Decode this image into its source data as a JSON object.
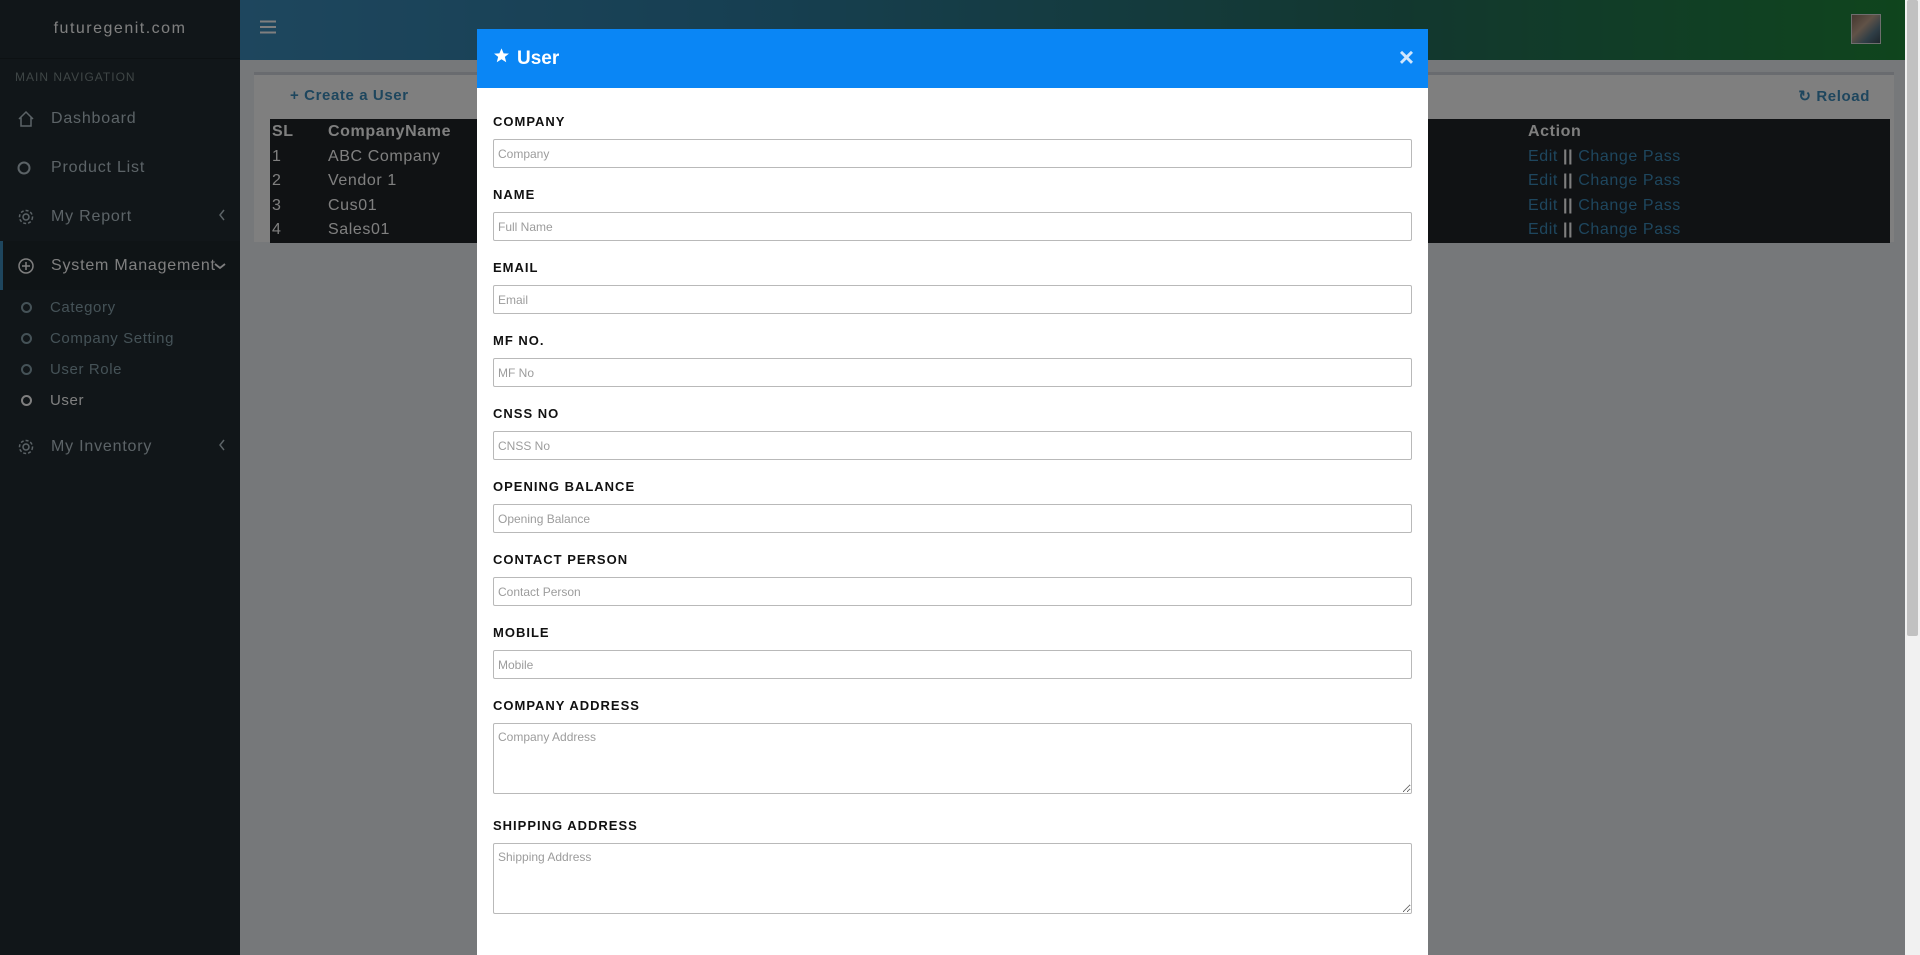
{
  "brand": "futuregenit.com",
  "sidebar": {
    "header": "MAIN NAVIGATION",
    "items": [
      {
        "label": "Dashboard"
      },
      {
        "label": "Product List"
      },
      {
        "label": "My Report"
      },
      {
        "label": "System Management"
      },
      {
        "label": "My Inventory"
      }
    ],
    "subitems": [
      {
        "label": "Category"
      },
      {
        "label": "Company Setting"
      },
      {
        "label": "User Role"
      },
      {
        "label": "User"
      }
    ]
  },
  "page": {
    "create_label": "Create a User",
    "reload_label": "Reload"
  },
  "table": {
    "headers": {
      "sl": "SL",
      "company": "CompanyName",
      "action": "Action"
    },
    "rows": [
      {
        "sl": "1",
        "company": "ABC Company"
      },
      {
        "sl": "2",
        "company": "Vendor 1"
      },
      {
        "sl": "3",
        "company": "Cus01"
      },
      {
        "sl": "4",
        "company": "Sales01"
      }
    ],
    "action_edit": "Edit",
    "action_sep": "||",
    "action_change": "Change Pass"
  },
  "modal": {
    "title": "User",
    "close": "×",
    "fields": [
      {
        "label": "COMPANY",
        "placeholder": "Company"
      },
      {
        "label": "NAME",
        "placeholder": "Full Name"
      },
      {
        "label": "EMAIL",
        "placeholder": "Email"
      },
      {
        "label": "MF NO.",
        "placeholder": "MF No"
      },
      {
        "label": "CNSS NO",
        "placeholder": "CNSS No"
      },
      {
        "label": "OPENING BALANCE",
        "placeholder": "Opening Balance"
      },
      {
        "label": "CONTACT PERSON",
        "placeholder": "Contact Person"
      },
      {
        "label": "MOBILE",
        "placeholder": "Mobile"
      },
      {
        "label": "COMPANY ADDRESS",
        "placeholder": "Company Address"
      },
      {
        "label": "SHIPPING ADDRESS",
        "placeholder": "Shipping Address"
      }
    ]
  },
  "colors": {
    "sidebar_bg": "#222d32",
    "accent": "#3c8dbc",
    "modal_header": "#0a86f5",
    "table_bg": "#212529"
  },
  "icons": [
    "hamburger-icon",
    "home-icon",
    "circle-icon",
    "gear-icon",
    "plus-circle-icon",
    "chevron-left-icon",
    "chevron-down-icon",
    "plus-icon",
    "refresh-icon",
    "star-icon",
    "close-icon"
  ]
}
